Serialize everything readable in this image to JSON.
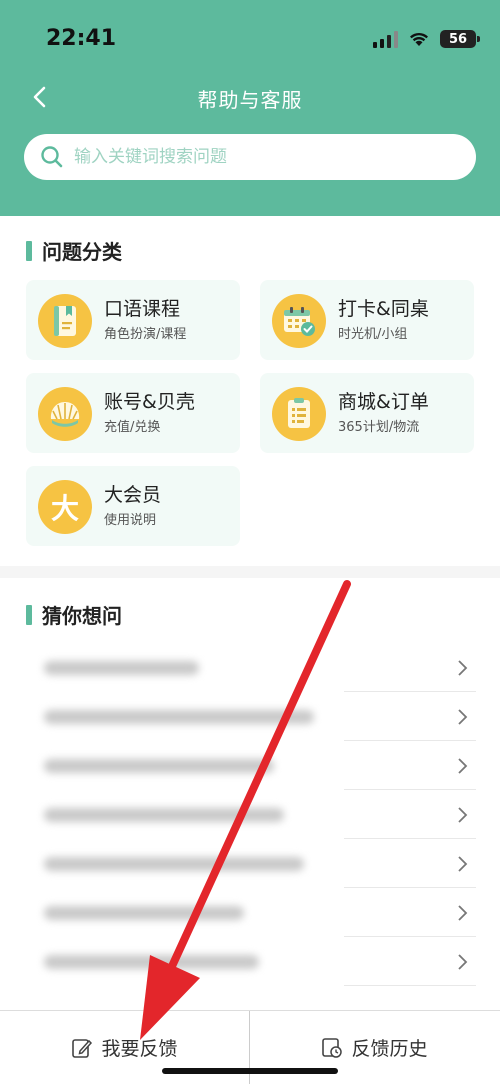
{
  "status": {
    "time": "22:41",
    "battery": "56"
  },
  "nav": {
    "title": "帮助与客服"
  },
  "search": {
    "placeholder": "输入关键词搜索问题",
    "value": ""
  },
  "categories_section": {
    "title": "问题分类",
    "items": [
      {
        "name": "口语课程",
        "sub": "角色扮演/课程",
        "icon": "book-icon"
      },
      {
        "name": "打卡&同桌",
        "sub": "时光机/小组",
        "icon": "calendar-check-icon"
      },
      {
        "name": "账号&贝壳",
        "sub": "充值/兑换",
        "icon": "shell-icon"
      },
      {
        "name": "商城&订单",
        "sub": "365计划/物流",
        "icon": "order-list-icon"
      },
      {
        "name": "大会员",
        "sub": "使用说明",
        "icon": "vip-da-icon"
      }
    ]
  },
  "guess_section": {
    "title": "猜你想问",
    "rows": 7
  },
  "bottom": {
    "feedback": "我要反馈",
    "history": "反馈历史"
  },
  "vip_glyph": "大",
  "colors": {
    "accent": "#5dba9d",
    "icon_bg": "#f6c343",
    "arrow": "#e3262b"
  }
}
